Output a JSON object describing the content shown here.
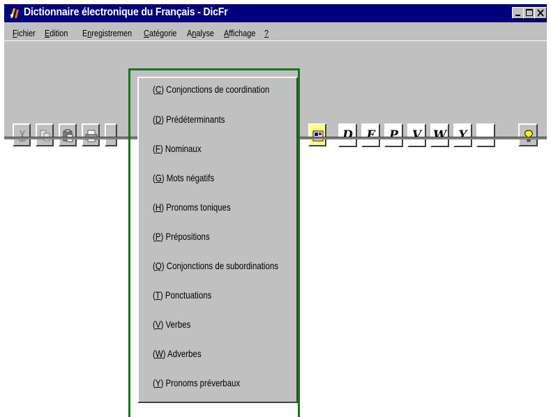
{
  "window": {
    "title": "Dictionnaire électronique du Français - DicFr",
    "app_icon": "dictionary-app-icon",
    "title_bar_color": "#00007b",
    "controls": [
      "minimize-icon",
      "maximize-icon",
      "close-icon"
    ]
  },
  "menu": {
    "fichier": {
      "hot": "F",
      "rest": "ichier"
    },
    "edition": {
      "hot": "E",
      "rest": "dition"
    },
    "enregistrement": {
      "pre": "E",
      "hot": "n",
      "rest": "registremen"
    },
    "categorie": {
      "hot": "C",
      "rest": "atégorie"
    },
    "analyse": {
      "pre": "A",
      "hot": "n",
      "rest": "alyse"
    },
    "affichage": {
      "hot": "A",
      "rest": "ffichage"
    },
    "help": {
      "hot": "?"
    },
    "highlight_color": "#14761e"
  },
  "toolbar": {
    "icons": [
      "cut-icon",
      "copy-icon",
      "paste-icon",
      "print-icon",
      "category-view-icon",
      "help-lightbulb-icon"
    ],
    "letters": [
      "D",
      "F",
      "P",
      "V",
      "W",
      "Y",
      "..."
    ]
  },
  "categorie_menu": {
    "items": [
      {
        "open": "(",
        "key": "C",
        "close": ")",
        "label": " Conjonctions de coordination"
      },
      {
        "open": "(",
        "key": "D",
        "close": ")",
        "label": " Prédéterminants"
      },
      {
        "open": "(",
        "key": "F",
        "close": ")",
        "label": " Nominaux"
      },
      {
        "open": "(",
        "key": "G",
        "close": ")",
        "label": " Mots négatifs"
      },
      {
        "open": "(",
        "key": "H",
        "close": ")",
        "label": " Pronoms toniques"
      },
      {
        "open": "(",
        "key": "P",
        "close": ")",
        "label": " Prépositions"
      },
      {
        "open": "(",
        "key": "Q",
        "close": ")",
        "label": " Conjonctions de subordinations"
      },
      {
        "open": "(",
        "key": "T",
        "close": ")",
        "label": " Ponctuations"
      },
      {
        "open": "(",
        "key": "V",
        "close": ")",
        "label": " Verbes"
      },
      {
        "open": "(",
        "key": "W",
        "close": ")",
        "label": " Adverbes"
      },
      {
        "open": "(",
        "key": "Y",
        "close": ")",
        "label": " Pronoms préverbaux"
      }
    ]
  }
}
